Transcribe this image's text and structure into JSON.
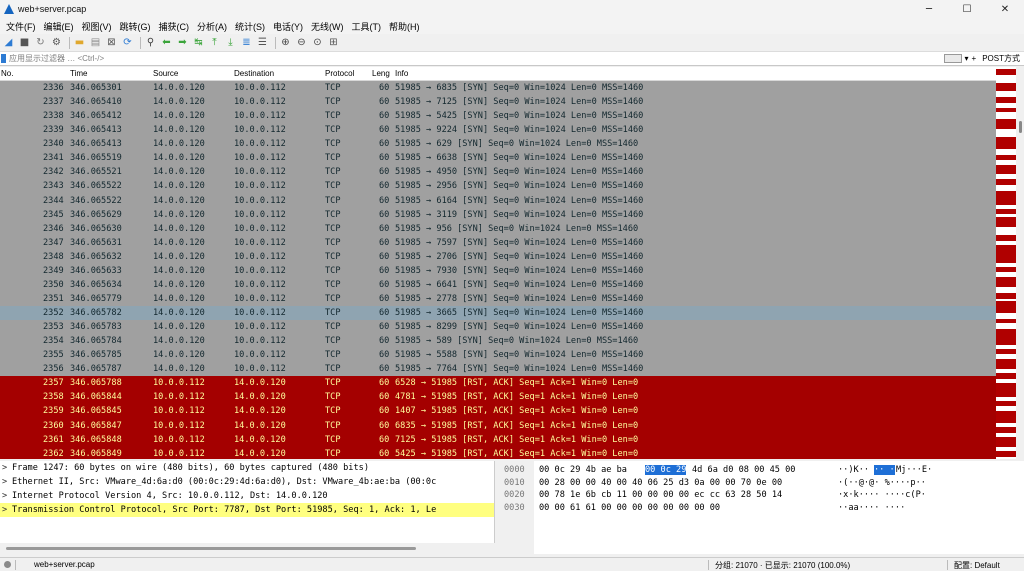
{
  "window": {
    "title": "web+server.pcap",
    "controls": [
      "─",
      "☐",
      "✕"
    ]
  },
  "menu": [
    "文件(F)",
    "编辑(E)",
    "视图(V)",
    "跳转(G)",
    "捕获(C)",
    "分析(A)",
    "统计(S)",
    "电话(Y)",
    "无线(W)",
    "工具(T)",
    "帮助(H)"
  ],
  "toolbar_icons": [
    {
      "name": "shark-fin-start-icon",
      "glyph": "◢",
      "color": "#2d7bd3"
    },
    {
      "name": "stop-icon",
      "glyph": "■",
      "color": "#555"
    },
    {
      "name": "restart-icon",
      "glyph": "↻",
      "color": "#777"
    },
    {
      "name": "options-icon",
      "glyph": "⚙",
      "color": "#555"
    },
    {
      "name": "sep"
    },
    {
      "name": "open-folder-icon",
      "glyph": "▬",
      "color": "#e0a82e"
    },
    {
      "name": "save-icon",
      "glyph": "▤",
      "color": "#888"
    },
    {
      "name": "close-file-icon",
      "glyph": "⊠",
      "color": "#555"
    },
    {
      "name": "reload-icon",
      "glyph": "⟳",
      "color": "#2d7bd3"
    },
    {
      "name": "sep"
    },
    {
      "name": "find-icon",
      "glyph": "⚲",
      "color": "#444"
    },
    {
      "name": "go-back-icon",
      "glyph": "⬅",
      "color": "#3aa43a"
    },
    {
      "name": "go-forward-icon",
      "glyph": "➡",
      "color": "#3aa43a"
    },
    {
      "name": "go-to-packet-icon",
      "glyph": "↹",
      "color": "#3aa43a"
    },
    {
      "name": "go-first-icon",
      "glyph": "⤒",
      "color": "#3aa43a"
    },
    {
      "name": "go-last-icon",
      "glyph": "⤓",
      "color": "#3aa43a"
    },
    {
      "name": "autoscroll-icon",
      "glyph": "≣",
      "color": "#2d7bd3"
    },
    {
      "name": "colorize-icon",
      "glyph": "☰",
      "color": "#555"
    },
    {
      "name": "sep"
    },
    {
      "name": "zoom-in-icon",
      "glyph": "⊕",
      "color": "#444"
    },
    {
      "name": "zoom-out-icon",
      "glyph": "⊖",
      "color": "#444"
    },
    {
      "name": "zoom-normal-icon",
      "glyph": "⊙",
      "color": "#444"
    },
    {
      "name": "resize-columns-icon",
      "glyph": "⊞",
      "color": "#555"
    }
  ],
  "filter": {
    "placeholder": "应用显示过滤器 … <Ctrl-/>",
    "arrow": "▾",
    "plus": "+",
    "post_button": "POST方式"
  },
  "columns": {
    "no": "No.",
    "time": "Time",
    "source": "Source",
    "destination": "Destination",
    "protocol": "Protocol",
    "length": "Leng",
    "info": "Info"
  },
  "packets": [
    {
      "no": "2336",
      "time": "346.065301",
      "src": "14.0.0.120",
      "dst": "10.0.0.112",
      "proto": "TCP",
      "len": "60",
      "info": "51985 → 6835 [SYN] Seq=0 Win=1024 Len=0 MSS=1460",
      "style": "syn"
    },
    {
      "no": "2337",
      "time": "346.065410",
      "src": "14.0.0.120",
      "dst": "10.0.0.112",
      "proto": "TCP",
      "len": "60",
      "info": "51985 → 7125 [SYN] Seq=0 Win=1024 Len=0 MSS=1460",
      "style": "syn"
    },
    {
      "no": "2338",
      "time": "346.065412",
      "src": "14.0.0.120",
      "dst": "10.0.0.112",
      "proto": "TCP",
      "len": "60",
      "info": "51985 → 5425 [SYN] Seq=0 Win=1024 Len=0 MSS=1460",
      "style": "syn"
    },
    {
      "no": "2339",
      "time": "346.065413",
      "src": "14.0.0.120",
      "dst": "10.0.0.112",
      "proto": "TCP",
      "len": "60",
      "info": "51985 → 9224 [SYN] Seq=0 Win=1024 Len=0 MSS=1460",
      "style": "syn"
    },
    {
      "no": "2340",
      "time": "346.065413",
      "src": "14.0.0.120",
      "dst": "10.0.0.112",
      "proto": "TCP",
      "len": "60",
      "info": "51985 → 629 [SYN] Seq=0 Win=1024 Len=0 MSS=1460",
      "style": "syn"
    },
    {
      "no": "2341",
      "time": "346.065519",
      "src": "14.0.0.120",
      "dst": "10.0.0.112",
      "proto": "TCP",
      "len": "60",
      "info": "51985 → 6638 [SYN] Seq=0 Win=1024 Len=0 MSS=1460",
      "style": "syn"
    },
    {
      "no": "2342",
      "time": "346.065521",
      "src": "14.0.0.120",
      "dst": "10.0.0.112",
      "proto": "TCP",
      "len": "60",
      "info": "51985 → 4950 [SYN] Seq=0 Win=1024 Len=0 MSS=1460",
      "style": "syn"
    },
    {
      "no": "2343",
      "time": "346.065522",
      "src": "14.0.0.120",
      "dst": "10.0.0.112",
      "proto": "TCP",
      "len": "60",
      "info": "51985 → 2956 [SYN] Seq=0 Win=1024 Len=0 MSS=1460",
      "style": "syn"
    },
    {
      "no": "2344",
      "time": "346.065522",
      "src": "14.0.0.120",
      "dst": "10.0.0.112",
      "proto": "TCP",
      "len": "60",
      "info": "51985 → 6164 [SYN] Seq=0 Win=1024 Len=0 MSS=1460",
      "style": "syn"
    },
    {
      "no": "2345",
      "time": "346.065629",
      "src": "14.0.0.120",
      "dst": "10.0.0.112",
      "proto": "TCP",
      "len": "60",
      "info": "51985 → 3119 [SYN] Seq=0 Win=1024 Len=0 MSS=1460",
      "style": "syn"
    },
    {
      "no": "2346",
      "time": "346.065630",
      "src": "14.0.0.120",
      "dst": "10.0.0.112",
      "proto": "TCP",
      "len": "60",
      "info": "51985 → 956 [SYN] Seq=0 Win=1024 Len=0 MSS=1460",
      "style": "syn"
    },
    {
      "no": "2347",
      "time": "346.065631",
      "src": "14.0.0.120",
      "dst": "10.0.0.112",
      "proto": "TCP",
      "len": "60",
      "info": "51985 → 7597 [SYN] Seq=0 Win=1024 Len=0 MSS=1460",
      "style": "syn"
    },
    {
      "no": "2348",
      "time": "346.065632",
      "src": "14.0.0.120",
      "dst": "10.0.0.112",
      "proto": "TCP",
      "len": "60",
      "info": "51985 → 2706 [SYN] Seq=0 Win=1024 Len=0 MSS=1460",
      "style": "syn"
    },
    {
      "no": "2349",
      "time": "346.065633",
      "src": "14.0.0.120",
      "dst": "10.0.0.112",
      "proto": "TCP",
      "len": "60",
      "info": "51985 → 7930 [SYN] Seq=0 Win=1024 Len=0 MSS=1460",
      "style": "syn"
    },
    {
      "no": "2350",
      "time": "346.065634",
      "src": "14.0.0.120",
      "dst": "10.0.0.112",
      "proto": "TCP",
      "len": "60",
      "info": "51985 → 6641 [SYN] Seq=0 Win=1024 Len=0 MSS=1460",
      "style": "syn"
    },
    {
      "no": "2351",
      "time": "346.065779",
      "src": "14.0.0.120",
      "dst": "10.0.0.112",
      "proto": "TCP",
      "len": "60",
      "info": "51985 → 2778 [SYN] Seq=0 Win=1024 Len=0 MSS=1460",
      "style": "syn"
    },
    {
      "no": "2352",
      "time": "346.065782",
      "src": "14.0.0.120",
      "dst": "10.0.0.112",
      "proto": "TCP",
      "len": "60",
      "info": "51985 → 3665 [SYN] Seq=0 Win=1024 Len=0 MSS=1460",
      "style": "sel"
    },
    {
      "no": "2353",
      "time": "346.065783",
      "src": "14.0.0.120",
      "dst": "10.0.0.112",
      "proto": "TCP",
      "len": "60",
      "info": "51985 → 8299 [SYN] Seq=0 Win=1024 Len=0 MSS=1460",
      "style": "syn"
    },
    {
      "no": "2354",
      "time": "346.065784",
      "src": "14.0.0.120",
      "dst": "10.0.0.112",
      "proto": "TCP",
      "len": "60",
      "info": "51985 → 589 [SYN] Seq=0 Win=1024 Len=0 MSS=1460",
      "style": "syn"
    },
    {
      "no": "2355",
      "time": "346.065785",
      "src": "14.0.0.120",
      "dst": "10.0.0.112",
      "proto": "TCP",
      "len": "60",
      "info": "51985 → 5588 [SYN] Seq=0 Win=1024 Len=0 MSS=1460",
      "style": "syn"
    },
    {
      "no": "2356",
      "time": "346.065787",
      "src": "14.0.0.120",
      "dst": "10.0.0.112",
      "proto": "TCP",
      "len": "60",
      "info": "51985 → 7764 [SYN] Seq=0 Win=1024 Len=0 MSS=1460",
      "style": "syn"
    },
    {
      "no": "2357",
      "time": "346.065788",
      "src": "10.0.0.112",
      "dst": "14.0.0.120",
      "proto": "TCP",
      "len": "60",
      "info": "6528 → 51985 [RST, ACK] Seq=1 Ack=1 Win=0 Len=0",
      "style": "rst"
    },
    {
      "no": "2358",
      "time": "346.065844",
      "src": "10.0.0.112",
      "dst": "14.0.0.120",
      "proto": "TCP",
      "len": "60",
      "info": "4781 → 51985 [RST, ACK] Seq=1 Ack=1 Win=0 Len=0",
      "style": "rst"
    },
    {
      "no": "2359",
      "time": "346.065845",
      "src": "10.0.0.112",
      "dst": "14.0.0.120",
      "proto": "TCP",
      "len": "60",
      "info": "1407 → 51985 [RST, ACK] Seq=1 Ack=1 Win=0 Len=0",
      "style": "rst"
    },
    {
      "no": "2360",
      "time": "346.065847",
      "src": "10.0.0.112",
      "dst": "14.0.0.120",
      "proto": "TCP",
      "len": "60",
      "info": "6835 → 51985 [RST, ACK] Seq=1 Ack=1 Win=0 Len=0",
      "style": "rst"
    },
    {
      "no": "2361",
      "time": "346.065848",
      "src": "10.0.0.112",
      "dst": "14.0.0.120",
      "proto": "TCP",
      "len": "60",
      "info": "7125 → 51985 [RST, ACK] Seq=1 Ack=1 Win=0 Len=0",
      "style": "rst"
    },
    {
      "no": "2362",
      "time": "346.065849",
      "src": "10.0.0.112",
      "dst": "14.0.0.120",
      "proto": "TCP",
      "len": "60",
      "info": "5425 → 51985 [RST, ACK] Seq=1 Ack=1 Win=0 Len=0",
      "style": "rst"
    }
  ],
  "details": [
    {
      "caret": ">",
      "text": "Frame 1247: 60 bytes on wire (480 bits), 60 bytes captured (480 bits)",
      "highlight": false
    },
    {
      "caret": ">",
      "text": "Ethernet II, Src: VMware_4d:6a:d0 (00:0c:29:4d:6a:d0), Dst: VMware_4b:ae:ba (00:0c",
      "highlight": false
    },
    {
      "caret": ">",
      "text": "Internet Protocol Version 4, Src: 10.0.0.112, Dst: 14.0.0.120",
      "highlight": false
    },
    {
      "caret": ">",
      "text": "Transmission Control Protocol, Src Port: 7787, Dst Port: 51985, Seq: 1, Ack: 1, Le",
      "highlight": true
    }
  ],
  "hex": [
    {
      "offset": "0000",
      "pre": "00 0c 29 4b ae ba ",
      "sel": "00 0c  29",
      "post": " 4d 6a d0 08 00 45 00",
      "ascii_pre": "··)K··",
      "ascii_sel": "··  ·",
      "ascii_post": "Mj···E·"
    },
    {
      "offset": "0010",
      "pre": "00 28 00 00 40 00 40 06  25 d3 0a 00 00 70 0e 00",
      "sel": "",
      "post": "",
      "ascii_pre": "·(··@·@· %····p··",
      "ascii_sel": "",
      "ascii_post": ""
    },
    {
      "offset": "0020",
      "pre": "00 78 1e 6b cb 11 00 00  00 00 ec cc 63 28 50 14",
      "sel": "",
      "post": "",
      "ascii_pre": "·x·k····  ····c(P·",
      "ascii_sel": "",
      "ascii_post": ""
    },
    {
      "offset": "0030",
      "pre": "00 00 61 61 00 00 00 00  00 00 00 00",
      "sel": "",
      "post": "",
      "ascii_pre": "··aa····  ····",
      "ascii_sel": "",
      "ascii_post": ""
    }
  ],
  "status": {
    "file": "web+server.pcap",
    "packets_label": "分组: 21070 · 已显示: 21070 (100.0%)",
    "profile_label": "配置: Default"
  },
  "colors": {
    "syn_row": "#a0a0a0",
    "selected_row": "#8fa4b1",
    "rst_row": "#a40000",
    "rst_text": "#fffc9c",
    "details_highlight": "#ffff80",
    "hex_select": "#1e6fd6"
  }
}
